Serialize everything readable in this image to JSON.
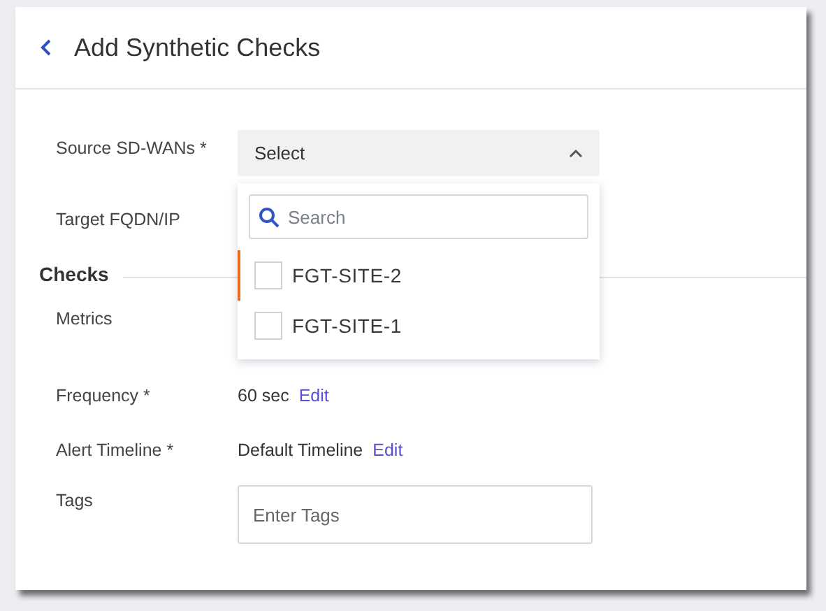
{
  "header": {
    "title": "Add Synthetic Checks"
  },
  "source": {
    "label": "Source SD-WANs *",
    "select": {
      "value": "Select",
      "expanded": true
    },
    "dropdown": {
      "search_placeholder": "Search",
      "options": [
        {
          "label": "FGT-SITE-2",
          "checked": false,
          "focused": true
        },
        {
          "label": "FGT-SITE-1",
          "checked": false,
          "focused": false
        }
      ]
    }
  },
  "target": {
    "label": "Target FQDN/IP"
  },
  "section": {
    "title": "Checks"
  },
  "metrics": {
    "label": "Metrics"
  },
  "frequency": {
    "label": "Frequency *",
    "value": "60 sec",
    "link": "Edit"
  },
  "alert_timeline": {
    "label": "Alert Timeline *",
    "value": "Default Timeline",
    "link": "Edit"
  },
  "tags": {
    "label": "Tags",
    "placeholder": "Enter Tags"
  }
}
